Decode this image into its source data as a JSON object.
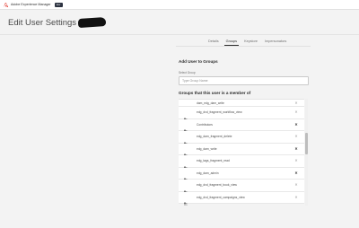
{
  "header": {
    "app_name": "Adobe Experience Manager",
    "badge": "dev"
  },
  "page": {
    "title": "Edit User Settings For Sa"
  },
  "tabs": [
    {
      "label": "Details"
    },
    {
      "label": "Groups"
    },
    {
      "label": "Keystore"
    },
    {
      "label": "Impersonators"
    }
  ],
  "add_group": {
    "title": "Add User to Groups",
    "field_label": "Select Group",
    "placeholder": "Type Group Name"
  },
  "groups": {
    "title": "Groups that this user is a member of",
    "rows": [
      {
        "label": "dam_edg_dam_write",
        "remove_style": "light"
      },
      {
        "label": "edg_dxd_fragment_workflow_view",
        "remove_style": "light"
      },
      {
        "label": "Contributors",
        "remove_style": "dark"
      },
      {
        "label": "edg_dam_fragment_delete",
        "remove_style": "light"
      },
      {
        "label": "edg_dam_write",
        "remove_style": "dark"
      },
      {
        "label": "edg_tags_fragment_read",
        "remove_style": "light"
      },
      {
        "label": "edg_dam_admin",
        "remove_style": "dark"
      },
      {
        "label": "edg_dxd_fragment_book_view",
        "remove_style": "light"
      },
      {
        "label": "edg_dxd_fragment_campaigns_view",
        "remove_style": "light"
      }
    ]
  },
  "colors": {
    "adobe_red": "#e1251b",
    "background": "#f3f3f3"
  },
  "icons": {
    "logo": "adobe-logo-icon",
    "row_icon": "user-group-icon",
    "remove": "close-icon"
  }
}
